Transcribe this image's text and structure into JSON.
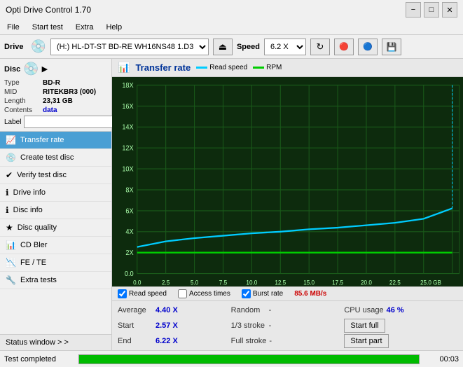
{
  "app": {
    "title": "Opti Drive Control 1.70",
    "title_controls": [
      "−",
      "□",
      "✕"
    ]
  },
  "menu": {
    "items": [
      "File",
      "Start test",
      "Extra",
      "Help"
    ]
  },
  "drive_bar": {
    "label": "Drive",
    "drive_value": "(H:) HL-DT-ST BD-RE  WH16NS48 1.D3",
    "speed_label": "Speed",
    "speed_value": "6.2 X"
  },
  "disc": {
    "type_label": "Type",
    "type_value": "BD-R",
    "mid_label": "MID",
    "mid_value": "RITEKBR3 (000)",
    "length_label": "Length",
    "length_value": "23,31 GB",
    "contents_label": "Contents",
    "contents_value": "data",
    "label_label": "Label",
    "label_value": ""
  },
  "nav": {
    "items": [
      {
        "id": "transfer-rate",
        "label": "Transfer rate",
        "active": true
      },
      {
        "id": "create-test-disc",
        "label": "Create test disc",
        "active": false
      },
      {
        "id": "verify-test-disc",
        "label": "Verify test disc",
        "active": false
      },
      {
        "id": "drive-info",
        "label": "Drive info",
        "active": false
      },
      {
        "id": "disc-info",
        "label": "Disc info",
        "active": false
      },
      {
        "id": "disc-quality",
        "label": "Disc quality",
        "active": false
      },
      {
        "id": "cd-bler",
        "label": "CD Bler",
        "active": false
      },
      {
        "id": "fe-te",
        "label": "FE / TE",
        "active": false
      },
      {
        "id": "extra-tests",
        "label": "Extra tests",
        "active": false
      }
    ],
    "status_window": "Status window > >"
  },
  "chart": {
    "title": "Transfer rate",
    "legend": [
      {
        "label": "Read speed",
        "color": "#00ccff"
      },
      {
        "label": "RPM",
        "color": "#00cc00"
      }
    ],
    "y_axis_labels": [
      "18X",
      "16X",
      "14X",
      "12X",
      "10X",
      "8X",
      "6X",
      "4X",
      "2X",
      "0.0"
    ],
    "x_axis_labels": [
      "0.0",
      "2.5",
      "5.0",
      "7.5",
      "10.0",
      "12.5",
      "15.0",
      "17.5",
      "20.0",
      "22.5",
      "25.0 GB"
    ]
  },
  "chart_controls": {
    "checkboxes": [
      {
        "label": "Read speed",
        "checked": true
      },
      {
        "label": "Access times",
        "checked": false
      },
      {
        "label": "Burst rate",
        "checked": true
      }
    ],
    "burst_value": "85.6 MB/s"
  },
  "stats": {
    "rows": [
      {
        "col1_label": "Average",
        "col1_value": "4.40 X",
        "col2_label": "Random",
        "col2_value": "-",
        "col3_label": "CPU usage",
        "col3_value": "46 %"
      },
      {
        "col1_label": "Start",
        "col1_value": "2.57 X",
        "col2_label": "1/3 stroke",
        "col2_value": "-",
        "col3_label": "",
        "col3_value": "",
        "btn_label": "Start full"
      },
      {
        "col1_label": "End",
        "col1_value": "6.22 X",
        "col2_label": "Full stroke",
        "col2_value": "-",
        "col3_label": "",
        "col3_value": "",
        "btn_label": "Start part"
      }
    ]
  },
  "status_bar": {
    "text": "Test completed",
    "progress": 100,
    "time": "00:03"
  }
}
